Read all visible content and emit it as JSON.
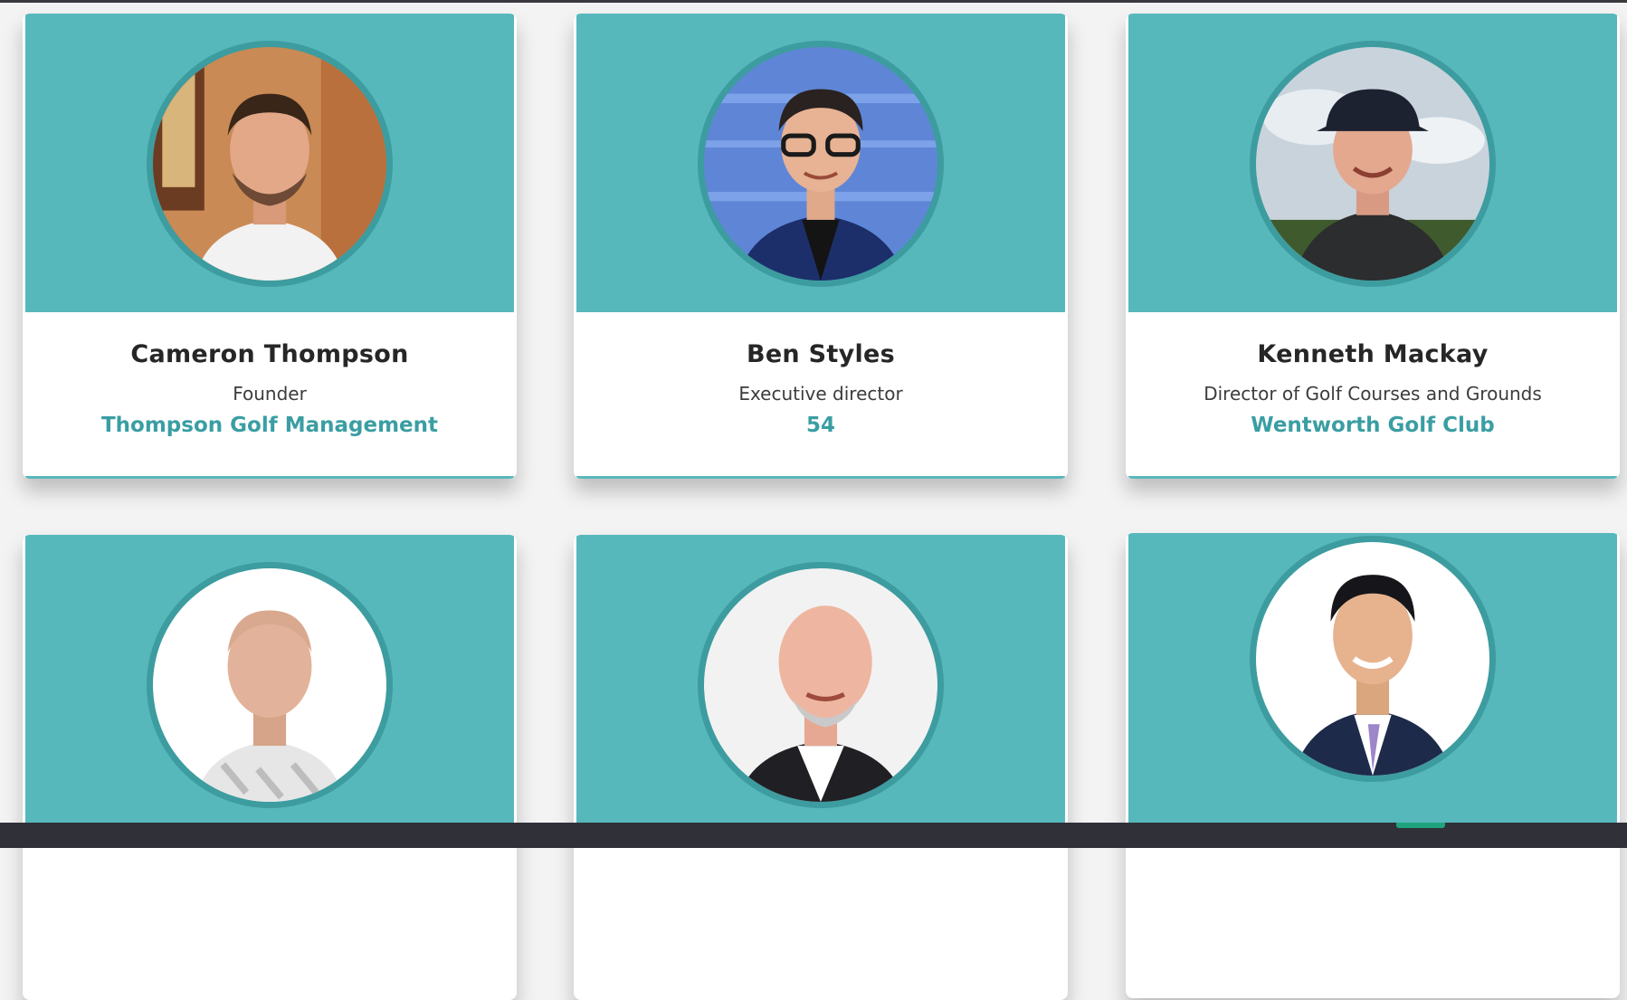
{
  "people": [
    {
      "name": "Cameron Thompson",
      "role": "Founder",
      "company": "Thompson Golf Management",
      "photo": "portrait-cameron-thompson"
    },
    {
      "name": "Ben Styles",
      "role": "Executive director",
      "company": "54",
      "photo": "portrait-ben-styles"
    },
    {
      "name": "Kenneth Mackay",
      "role": "Director of Golf Courses and Grounds",
      "company": "Wentworth Golf Club",
      "photo": "portrait-kenneth-mackay"
    },
    {
      "name": "",
      "role": "",
      "company": "",
      "photo": "portrait-person-4"
    },
    {
      "name": "",
      "role": "",
      "company": "",
      "photo": "portrait-person-5"
    },
    {
      "name": "",
      "role": "",
      "company": "",
      "photo": "portrait-person-6"
    }
  ],
  "colors": {
    "banner": "#57b8bc",
    "ring": "#3d9c9f",
    "company_text": "#3a9ea3",
    "footer_bar": "#2f3038",
    "footer_accent": "#1fa27f"
  }
}
